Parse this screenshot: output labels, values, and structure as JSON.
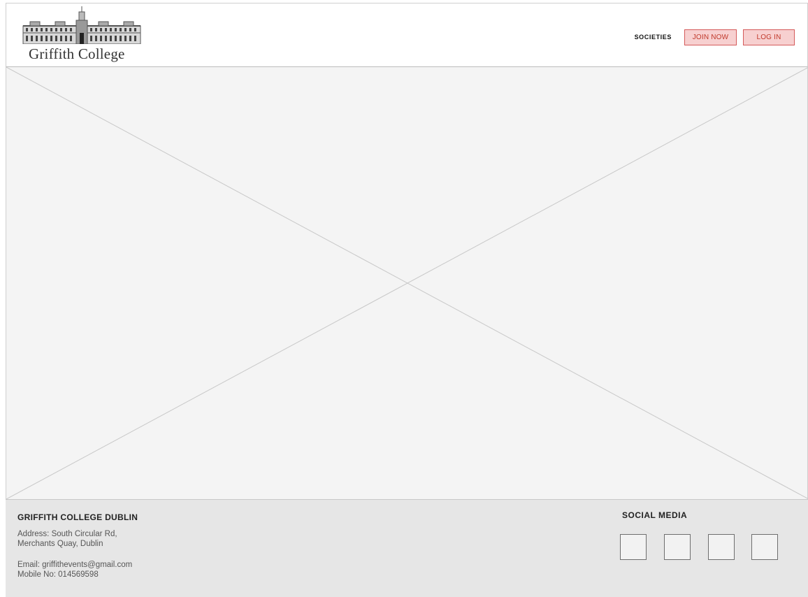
{
  "header": {
    "logo_text": "Griffith College",
    "nav": {
      "societies_label": "SOCIETIES",
      "join_label": "JOIN NOW",
      "login_label": "LOG IN"
    }
  },
  "footer": {
    "title": "GRIFFITH COLLEGE DUBLIN",
    "address_line1": "Address: South Circular Rd,",
    "address_line2": "Merchants Quay, Dublin",
    "email": "Email: griffithevents@gmail.com",
    "mobile": "Mobile No: 014569598",
    "social_title": "SOCIAL MEDIA"
  },
  "colors": {
    "button_fill": "#f7d0d0",
    "button_border": "#d45a5a",
    "button_text": "#c0392b",
    "hero_bg": "#f4f4f4",
    "footer_bg": "#e6e6e6"
  }
}
